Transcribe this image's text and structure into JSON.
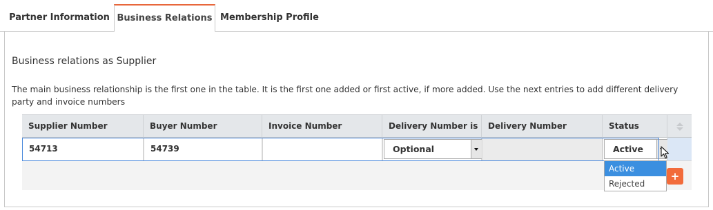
{
  "tabs": [
    {
      "label": "Partner Information"
    },
    {
      "label": "Business Relations",
      "active": true
    },
    {
      "label": "Membership Profile"
    }
  ],
  "section": {
    "title": "Business relations as Supplier",
    "description": "The main business relationship is the first one in the table. It is the first one added or first active, if more added. Use the next entries to add different delivery party and invoice numbers"
  },
  "table": {
    "columns": [
      "Supplier Number",
      "Buyer Number",
      "Invoice Number",
      "Delivery Number is",
      "Delivery Number",
      "Status"
    ],
    "rows": [
      {
        "supplier_number": "54713",
        "buyer_number": "54739",
        "invoice_number": "",
        "delivery_number_is": "Optional",
        "delivery_number": "",
        "status": "Active"
      }
    ]
  },
  "status_dropdown": {
    "options": [
      "Active",
      "Rejected"
    ],
    "highlighted": "Active"
  },
  "add_button": {
    "icon": "plus-icon",
    "symbol": "+"
  },
  "colors": {
    "accent": "#e8673b",
    "selection": "#3b8fe0",
    "row_outline": "#4a89dc"
  }
}
